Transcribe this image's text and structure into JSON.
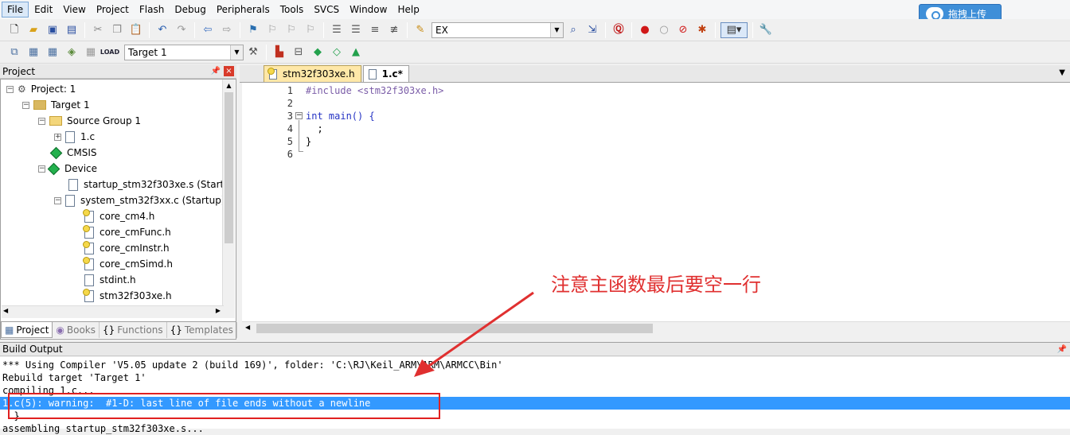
{
  "menubar": {
    "items": [
      "File",
      "Edit",
      "View",
      "Project",
      "Flash",
      "Debug",
      "Peripherals",
      "Tools",
      "SVCS",
      "Window",
      "Help"
    ]
  },
  "upload_button": {
    "label": "拖拽上传"
  },
  "toolbar1": {
    "icons": [
      "new-file-icon",
      "open-file-icon",
      "save-icon",
      "save-all-icon",
      "cut-icon",
      "copy-icon",
      "paste-icon",
      "undo-icon",
      "redo-icon",
      "nav-back-icon",
      "nav-forward-icon",
      "bookmark-icon",
      "prev-bookmark-icon",
      "next-bookmark-icon",
      "clear-bookmarks-icon",
      "indent-icon",
      "unindent-icon",
      "comment-icon",
      "uncomment-icon",
      "find-in-files-icon"
    ],
    "find_combo_value": "EX"
  },
  "toolbar2": {
    "target_combo_value": "Target 1"
  },
  "project_panel": {
    "title": "Project",
    "tree": [
      {
        "label": "Project: 1",
        "level": 0,
        "kind": "project",
        "expander": "−"
      },
      {
        "label": "Target 1",
        "level": 1,
        "kind": "target",
        "expander": "−"
      },
      {
        "label": "Source Group 1",
        "level": 2,
        "kind": "folder",
        "expander": "−"
      },
      {
        "label": "1.c",
        "level": 3,
        "kind": "file",
        "expander": "+"
      },
      {
        "label": "CMSIS",
        "level": 2,
        "kind": "component",
        "expander": ""
      },
      {
        "label": "Device",
        "level": 2,
        "kind": "component",
        "expander": "−"
      },
      {
        "label": "startup_stm32f303xe.s (Startup)",
        "level": 3,
        "kind": "file",
        "expander": ""
      },
      {
        "label": "system_stm32f3xx.c (Startup)",
        "level": 3,
        "kind": "file",
        "expander": "−"
      },
      {
        "label": "core_cm4.h",
        "level": 4,
        "kind": "header",
        "expander": ""
      },
      {
        "label": "core_cmFunc.h",
        "level": 4,
        "kind": "header",
        "expander": ""
      },
      {
        "label": "core_cmInstr.h",
        "level": 4,
        "kind": "header",
        "expander": ""
      },
      {
        "label": "core_cmSimd.h",
        "level": 4,
        "kind": "header",
        "expander": ""
      },
      {
        "label": "stdint.h",
        "level": 4,
        "kind": "file",
        "expander": ""
      },
      {
        "label": "stm32f303xe.h",
        "level": 4,
        "kind": "header",
        "expander": ""
      }
    ],
    "tabs": [
      "Project",
      "Books",
      "Functions",
      "Templates"
    ],
    "tab_glyphs": [
      "▦",
      "◉",
      "{}",
      "{}"
    ]
  },
  "editor": {
    "tabs": [
      "stm32f303xe.h",
      "1.c*"
    ],
    "lines": [
      {
        "num": "1",
        "text": "#include <stm32f303xe.h>"
      },
      {
        "num": "2",
        "text": ""
      },
      {
        "num": "3",
        "text": "int main() {"
      },
      {
        "num": "4",
        "text": "  ;"
      },
      {
        "num": "5",
        "text": "}"
      },
      {
        "num": "6",
        "text": ""
      }
    ]
  },
  "build_output": {
    "title": "Build Output",
    "lines": [
      "*** Using Compiler 'V5.05 update 2 (build 169)', folder: 'C:\\RJ\\Keil_ARM\\ARM\\ARMCC\\Bin'",
      "Rebuild target 'Target 1'",
      "compiling 1.c...",
      "1.c(5): warning:  #1-D: last line of file ends without a newline",
      "  }",
      "assembling startup_stm32f303xe.s..."
    ],
    "selected_line": 3
  },
  "annotation": {
    "text": "注意主函数最后要空一行",
    "color": "#e03030"
  }
}
